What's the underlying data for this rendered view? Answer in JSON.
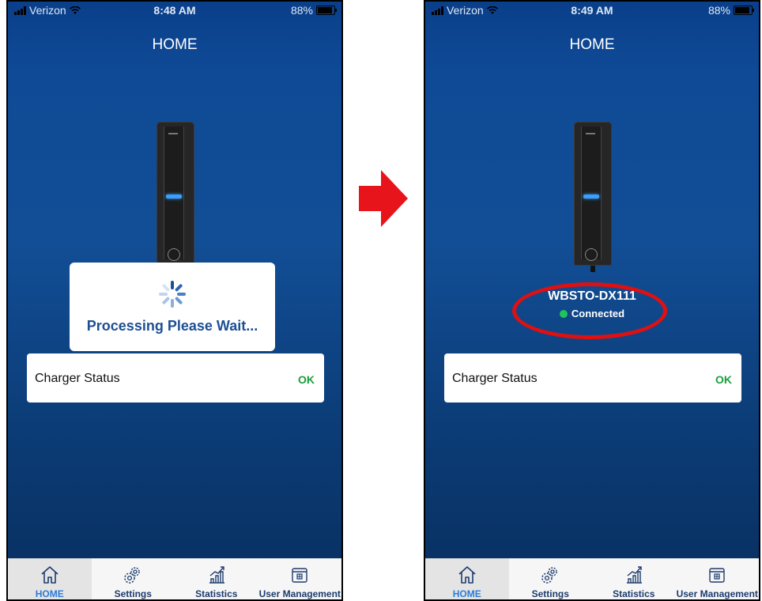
{
  "left_screen": {
    "status_bar": {
      "carrier": "Verizon",
      "time": "8:48 AM",
      "battery": "88%"
    },
    "title": "HOME",
    "dialog": {
      "message": "Processing Please Wait..."
    },
    "charger_status": {
      "label": "Charger Status",
      "value": "OK"
    },
    "tabs": [
      {
        "label": "HOME",
        "icon": "home-icon",
        "active": true
      },
      {
        "label": "Settings",
        "icon": "gear-icon",
        "active": false
      },
      {
        "label": "Statistics",
        "icon": "chart-icon",
        "active": false
      },
      {
        "label": "User Management",
        "icon": "calendar-icon",
        "active": false
      }
    ]
  },
  "right_screen": {
    "status_bar": {
      "carrier": "Verizon",
      "time": "8:49 AM",
      "battery": "88%"
    },
    "title": "HOME",
    "device": {
      "name": "WBSTO-DX111",
      "connection": "Connected"
    },
    "charger_status": {
      "label": "Charger Status",
      "value": "OK"
    },
    "tabs": [
      {
        "label": "HOME",
        "icon": "home-icon",
        "active": true
      },
      {
        "label": "Settings",
        "icon": "gear-icon",
        "active": false
      },
      {
        "label": "Statistics",
        "icon": "chart-icon",
        "active": false
      },
      {
        "label": "User Management",
        "icon": "calendar-icon",
        "active": false
      }
    ]
  },
  "colors": {
    "accent": "#2e7bd6",
    "ok_green": "#1a9e3c",
    "connected_dot": "#1fc35a",
    "highlight_red": "#e01010",
    "arrow_red": "#e8141c"
  }
}
